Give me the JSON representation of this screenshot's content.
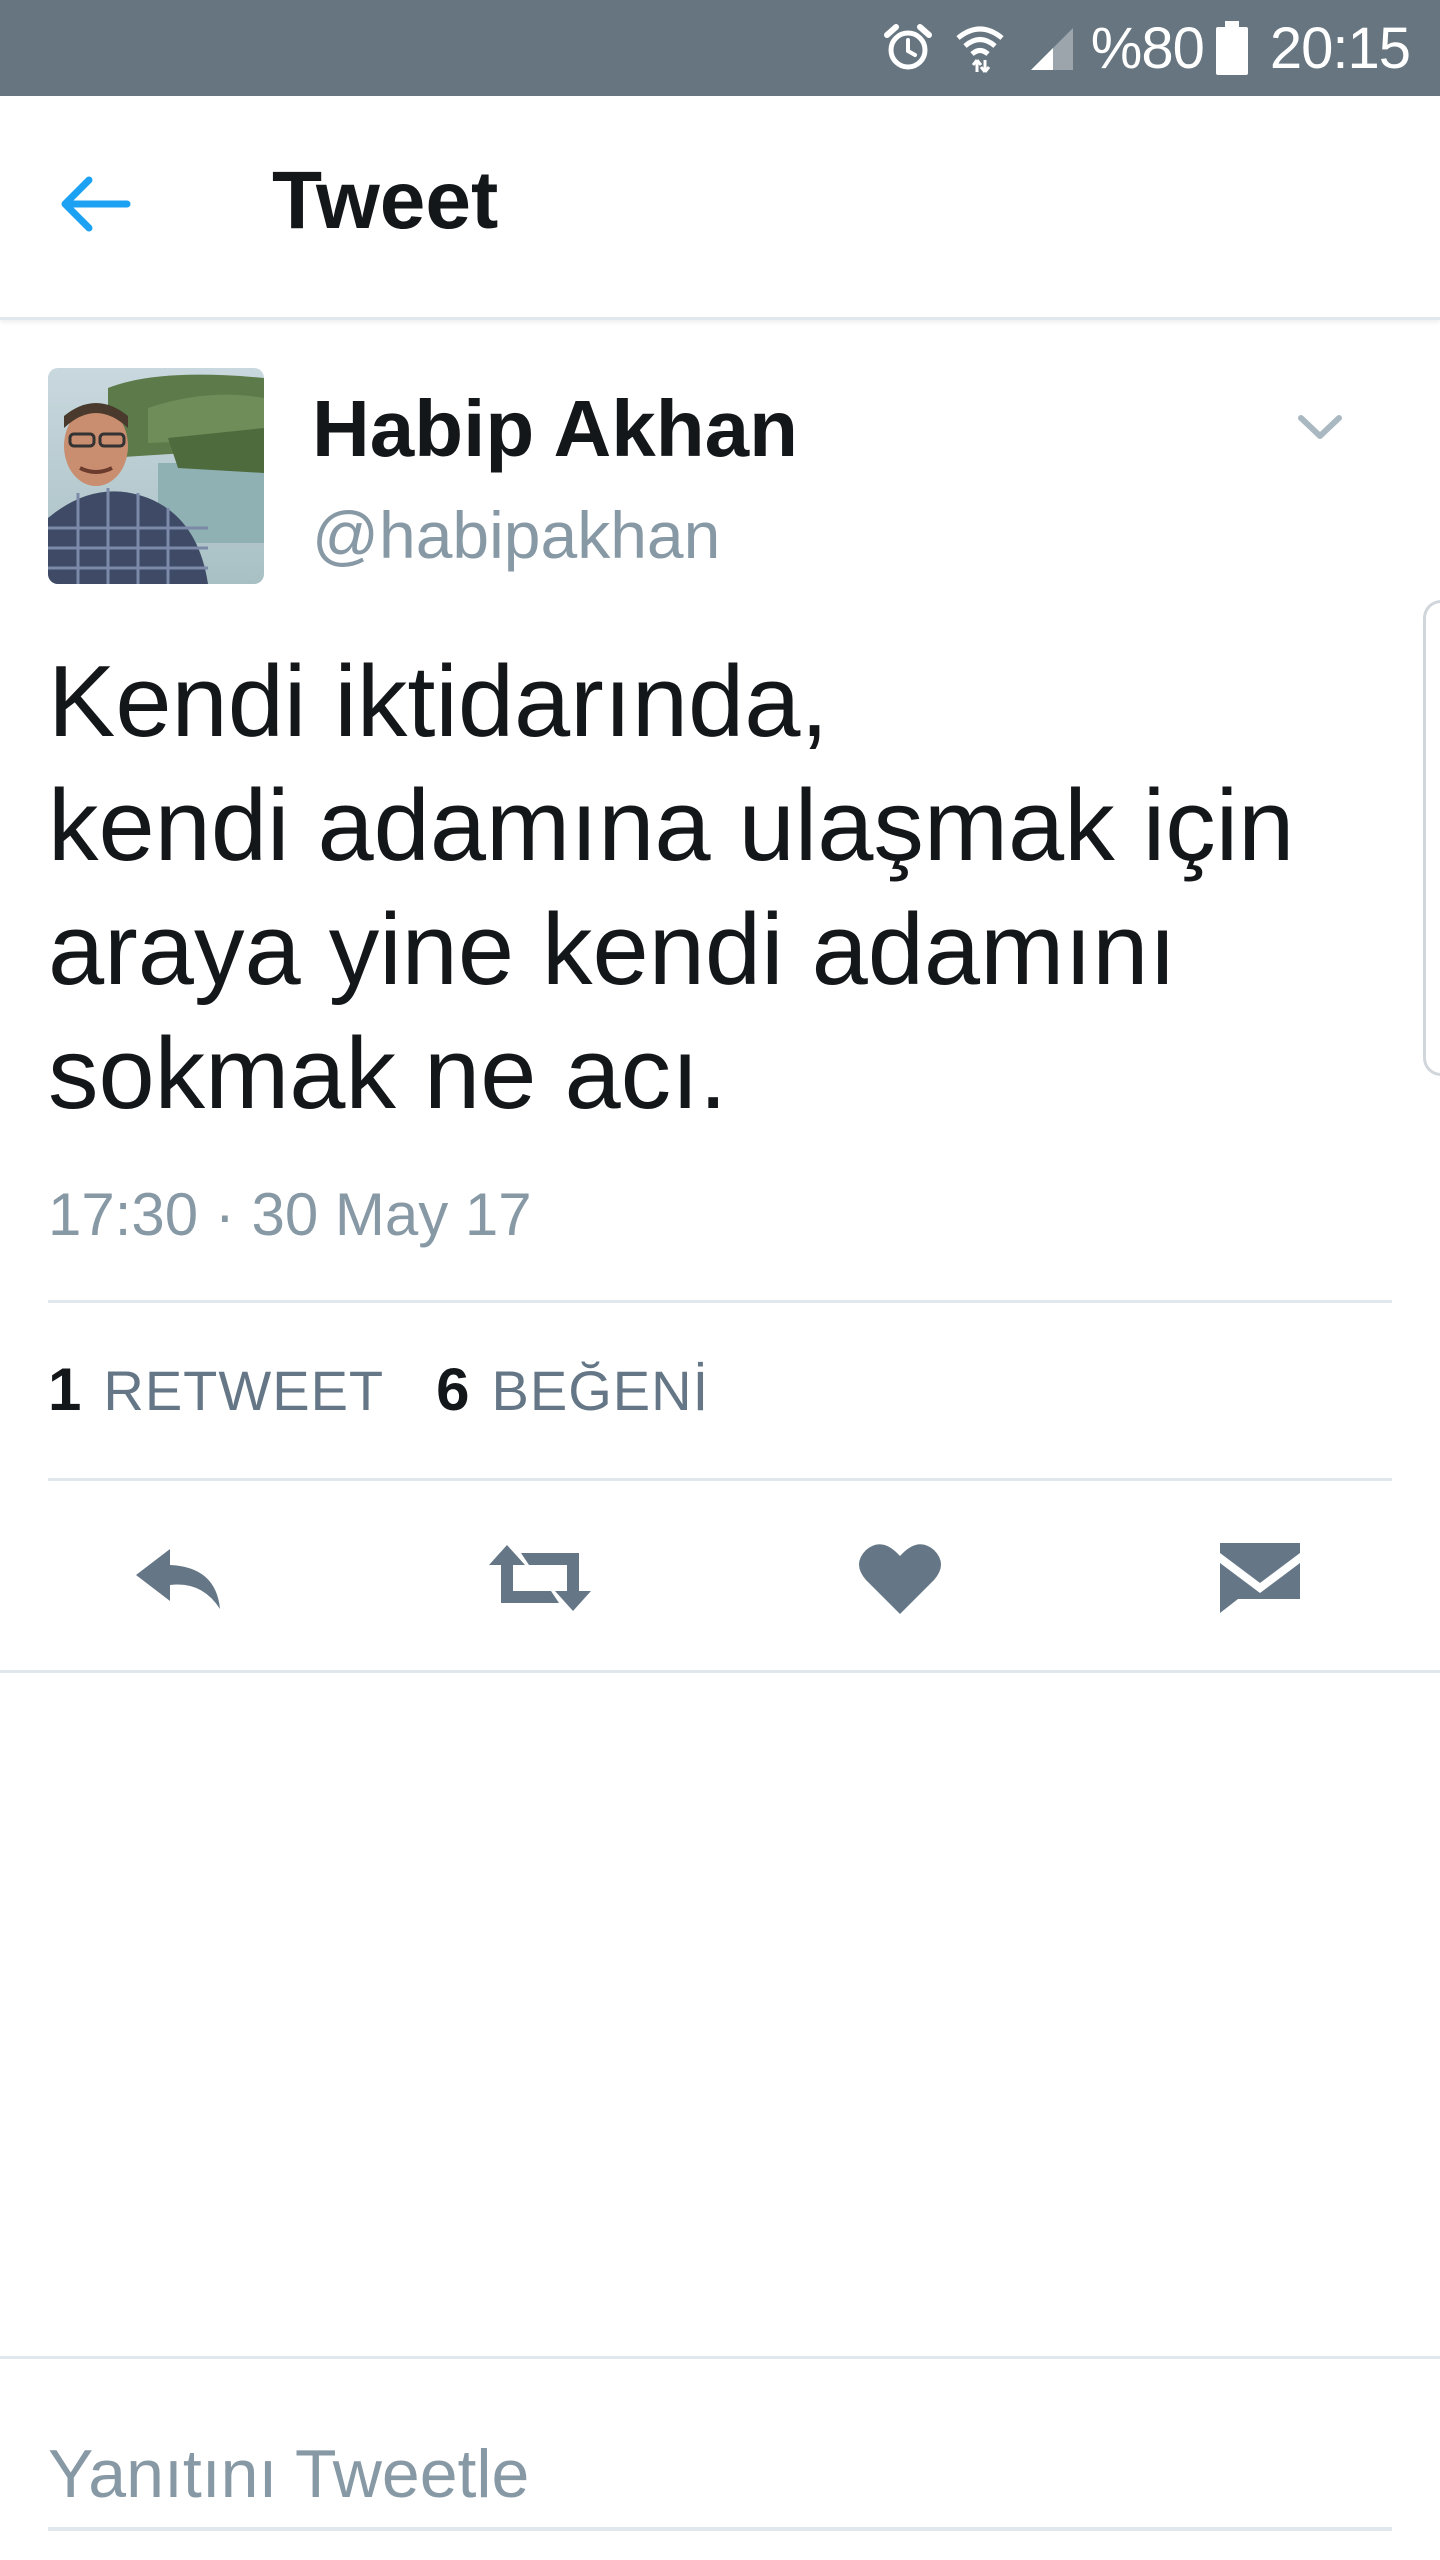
{
  "status_bar": {
    "battery": "%80",
    "time": "20:15",
    "icons": [
      "alarm-icon",
      "wifi-icon",
      "signal-icon",
      "battery-icon"
    ]
  },
  "header": {
    "title": "Tweet",
    "back_icon": "back-arrow-icon"
  },
  "tweet": {
    "author_name": "Habip Akhan",
    "author_handle": "@habipakhan",
    "text_lines": [
      "Kendi iktidarında,",
      "kendi adamına ulaşmak için",
      "araya yine kendi adamını",
      "sokmak ne acı."
    ],
    "timestamp": "17:30 · 30 May 17",
    "stats": {
      "retweet_count": "1",
      "retweet_label": "RETWEET",
      "like_count": "6",
      "like_label": "BEĞENİ"
    },
    "actions": [
      "reply-icon",
      "retweet-icon",
      "like-heart-icon",
      "direct-message-icon"
    ]
  },
  "reply": {
    "placeholder": "Yanıtını Tweetle"
  },
  "colors": {
    "status_bar_bg": "#66757f",
    "accent_blue": "#1da1f2",
    "icon_gray": "#657786",
    "muted_text": "#8899a6",
    "divider": "#e1e8ed"
  }
}
